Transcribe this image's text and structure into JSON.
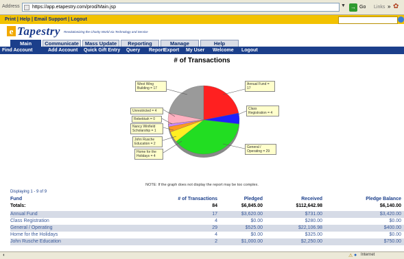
{
  "browser": {
    "address_label": "Address",
    "url": "https://app.etapestry.com/prod/Main.jsp",
    "go_label": "Go",
    "links_label": "Links",
    "links_more": "»",
    "status_zone": "Internet"
  },
  "top_links": {
    "print": "Print",
    "help": "Help",
    "email_support": "Email Support",
    "logout": "Logout",
    "separator": "|"
  },
  "brand": {
    "logo_letter": "e",
    "name": "Tapestry",
    "tagline": "Revolutionizing the Charity World via Technology and Service"
  },
  "tabs": [
    {
      "label": "Main",
      "active": true
    },
    {
      "label": "Communicate",
      "active": false
    },
    {
      "label": "Mass Update",
      "active": false
    },
    {
      "label": "Reporting",
      "active": false
    },
    {
      "label": "Manage",
      "active": false
    },
    {
      "label": "Help",
      "active": false
    }
  ],
  "subnav": [
    "Find Account",
    "Add Account",
    "Quick Gift Entry",
    "Query",
    "Report",
    "Export",
    "My User",
    "Welcome",
    "Logout"
  ],
  "chart_data": {
    "type": "pie",
    "title": "# of Transactions",
    "slices": [
      {
        "label": "West Wing Building",
        "value": 17,
        "color": "#9a9a9a"
      },
      {
        "label": "Annual Fund",
        "value": 17,
        "color": "#ff2020"
      },
      {
        "label": "Class Registration",
        "value": 4,
        "color": "#2020ff"
      },
      {
        "label": "General / Operating",
        "value": 29,
        "color": "#22dd22"
      },
      {
        "label": "Home for the Holidays",
        "value": 4,
        "color": "#ffee22"
      },
      {
        "label": "John Rusche Education",
        "value": 2,
        "color": "#ff9922"
      },
      {
        "label": "Nancy Winfield Scholarship",
        "value": 1,
        "color": "#cc88ff"
      },
      {
        "label": "Rebekkah",
        "value": 0,
        "color": "#cccccc"
      },
      {
        "label": "Unrestricted",
        "value": 4,
        "color": "#ffb0c0"
      }
    ],
    "callouts": [
      {
        "lines": [
          "West Wing",
          "Building = 17"
        ]
      },
      {
        "lines": [
          "Annual Fund =",
          "17"
        ]
      },
      {
        "lines": [
          "Class",
          "Registration = 4"
        ]
      },
      {
        "lines": [
          "Unrestricted = 4"
        ]
      },
      {
        "lines": [
          "Rebekkah = 0"
        ]
      },
      {
        "lines": [
          "Nancy Winfield",
          "Scholarship = 1"
        ]
      },
      {
        "lines": [
          "John Rusche",
          "Education = 2"
        ]
      },
      {
        "lines": [
          "Home for the",
          "Holidays = 4"
        ]
      },
      {
        "lines": [
          "General /",
          "Operating = 29"
        ]
      }
    ]
  },
  "note": "NOTE: If the graph does not display the report may be too complex.",
  "table": {
    "displaying": "Displaying 1 - 9 of 9",
    "headers": [
      "Fund",
      "# of Transactions",
      "Pledged",
      "Received",
      "Pledge Balance"
    ],
    "totals": [
      "Totals:",
      "84",
      "$6,845.00",
      "$112,642.98",
      "$6,140.00"
    ],
    "rows": [
      [
        "Annual Fund",
        "17",
        "$3,620.00",
        "$731.00",
        "$3,420.00"
      ],
      [
        "Class Registration",
        "4",
        "$0.00",
        "$280.00",
        "$0.00"
      ],
      [
        "General / Operating",
        "29",
        "$525.00",
        "$22,106.98",
        "$400.00"
      ],
      [
        "Home for the Holidays",
        "4",
        "$0.00",
        "$325.00",
        "$0.00"
      ],
      [
        "John Rusche Education",
        "2",
        "$1,000.00",
        "$2,250.00",
        "$750.00"
      ]
    ]
  }
}
